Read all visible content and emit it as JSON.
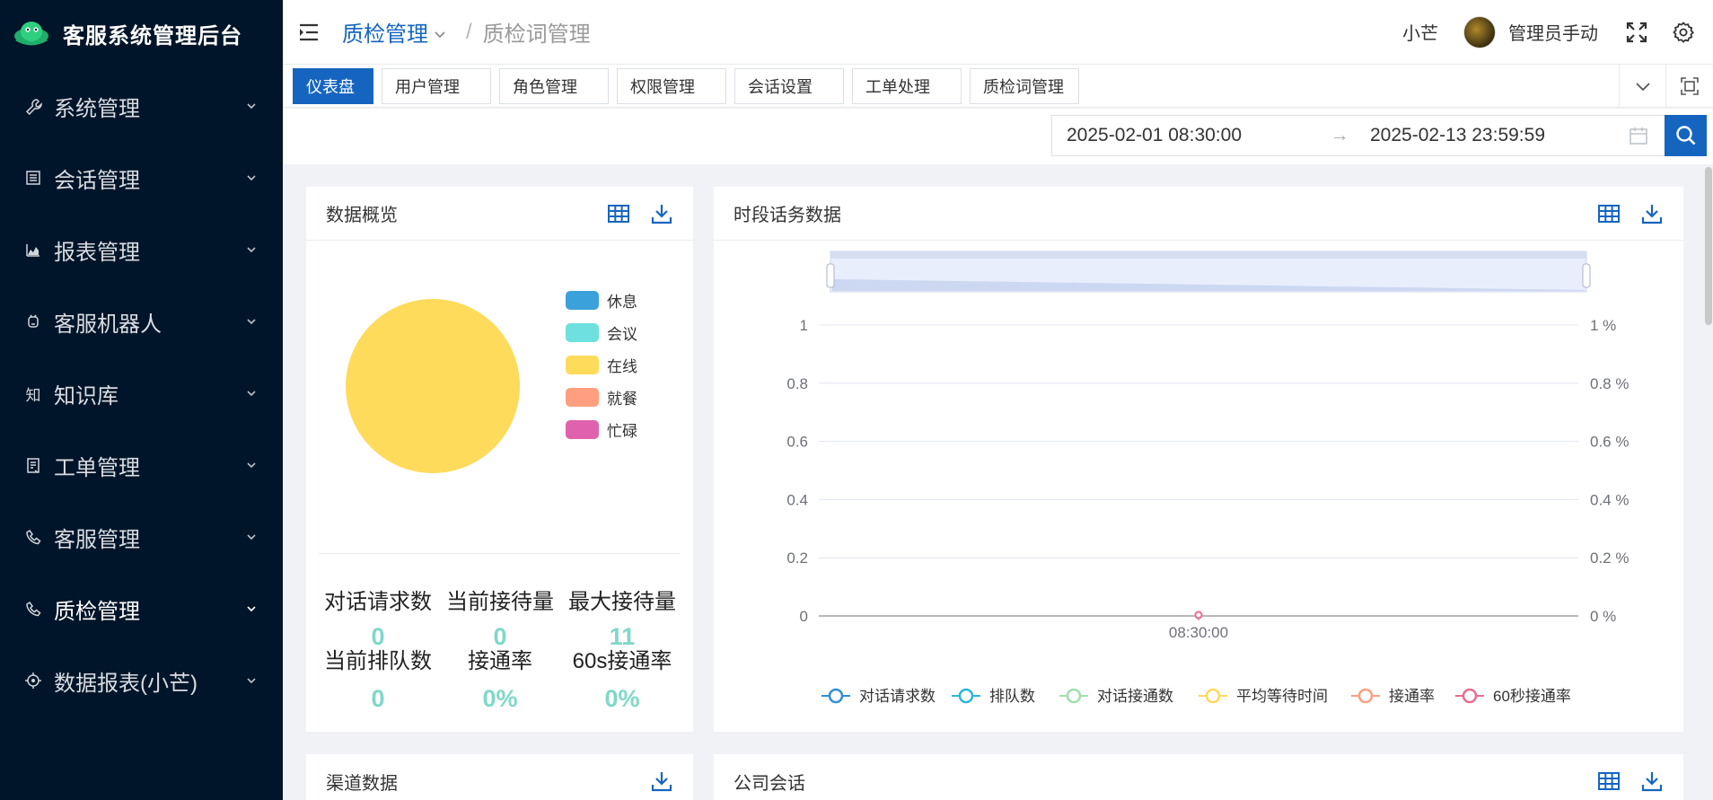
{
  "app": {
    "title": "客服系统管理后台",
    "colors": {
      "sidebar_bg": "#001529",
      "accent": "#1565c0",
      "stat_value": "#7fd8c8"
    }
  },
  "sidebar": {
    "items": [
      {
        "label": "系统管理",
        "icon": "wrench-icon"
      },
      {
        "label": "会话管理",
        "icon": "list-icon"
      },
      {
        "label": "报表管理",
        "icon": "area-chart-icon"
      },
      {
        "label": "客服机器人",
        "icon": "robot-icon"
      },
      {
        "label": "知识库",
        "icon": "zhi-char-icon",
        "glyph": "知"
      },
      {
        "label": "工单管理",
        "icon": "ticket-icon"
      },
      {
        "label": "客服管理",
        "icon": "phone-icon"
      },
      {
        "label": "质检管理",
        "icon": "phone-icon",
        "active": true
      },
      {
        "label": "数据报表(小芒)",
        "icon": "target-icon"
      }
    ]
  },
  "header": {
    "breadcrumb": [
      "质检管理",
      "/",
      "质检词管理"
    ],
    "user_short": "小芒",
    "user_name": "管理员手动"
  },
  "tabs": [
    {
      "label": "仪表盘",
      "active": true
    },
    {
      "label": "用户管理"
    },
    {
      "label": "角色管理"
    },
    {
      "label": "权限管理"
    },
    {
      "label": "会话设置"
    },
    {
      "label": "工单处理"
    },
    {
      "label": "质检词管理"
    }
  ],
  "date_range": {
    "start": "2025-02-01 08:30:00",
    "separator": "→",
    "end": "2025-02-13 23:59:59"
  },
  "overview": {
    "title": "数据概览",
    "legend": [
      {
        "label": "休息",
        "color": "#3ba1db"
      },
      {
        "label": "会议",
        "color": "#6ee0e0"
      },
      {
        "label": "在线",
        "color": "#ffdb5c"
      },
      {
        "label": "就餐",
        "color": "#ff9f7f"
      },
      {
        "label": "忙碌",
        "color": "#e062ae"
      }
    ],
    "stats_row1": [
      {
        "label": "对话请求数",
        "value": "0"
      },
      {
        "label": "当前接待量",
        "value": "0"
      },
      {
        "label": "最大接待量",
        "value": "11"
      }
    ],
    "stats_row2": [
      {
        "label": "当前排队数",
        "value": "0"
      },
      {
        "label": "接通率",
        "value": "0%"
      },
      {
        "label": "60s接通率",
        "value": "0%"
      }
    ]
  },
  "period": {
    "title": "时段话务数据"
  },
  "channel": {
    "title": "渠道数据"
  },
  "company": {
    "title": "公司会话"
  },
  "chart_data": [
    {
      "type": "pie",
      "title": "数据概览",
      "categories": [
        "休息",
        "会议",
        "在线",
        "就餐",
        "忙碌"
      ],
      "values": [
        0,
        0,
        1,
        0,
        0
      ],
      "colors": [
        "#3ba1db",
        "#6ee0e0",
        "#ffdb5c",
        "#ff9f7f",
        "#e062ae"
      ],
      "legend": "right"
    },
    {
      "type": "line",
      "title": "时段话务数据",
      "x": [
        "08:30:00"
      ],
      "y_left_ticks": [
        "0",
        "0.2",
        "0.4",
        "0.6",
        "0.8",
        "1"
      ],
      "y_right_ticks": [
        "0 %",
        "0.2 %",
        "0.4 %",
        "0.6 %",
        "0.8 %",
        "1 %"
      ],
      "ylim": [
        0,
        1
      ],
      "grid": true,
      "legend": "bottom",
      "series": [
        {
          "name": "对话请求数",
          "values": [
            0
          ],
          "color": "#2f8fd6"
        },
        {
          "name": "排队数",
          "values": [
            0
          ],
          "color": "#2bb7d9"
        },
        {
          "name": "对话接通数",
          "values": [
            0
          ],
          "color": "#9ee0ab"
        },
        {
          "name": "平均等待时间",
          "values": [
            0
          ],
          "color": "#ffd85c"
        },
        {
          "name": "接通率",
          "values": [
            0
          ],
          "color": "#ff9f7f"
        },
        {
          "name": "60秒接通率",
          "values": [
            0
          ],
          "color": "#eb6b8f"
        }
      ]
    }
  ]
}
